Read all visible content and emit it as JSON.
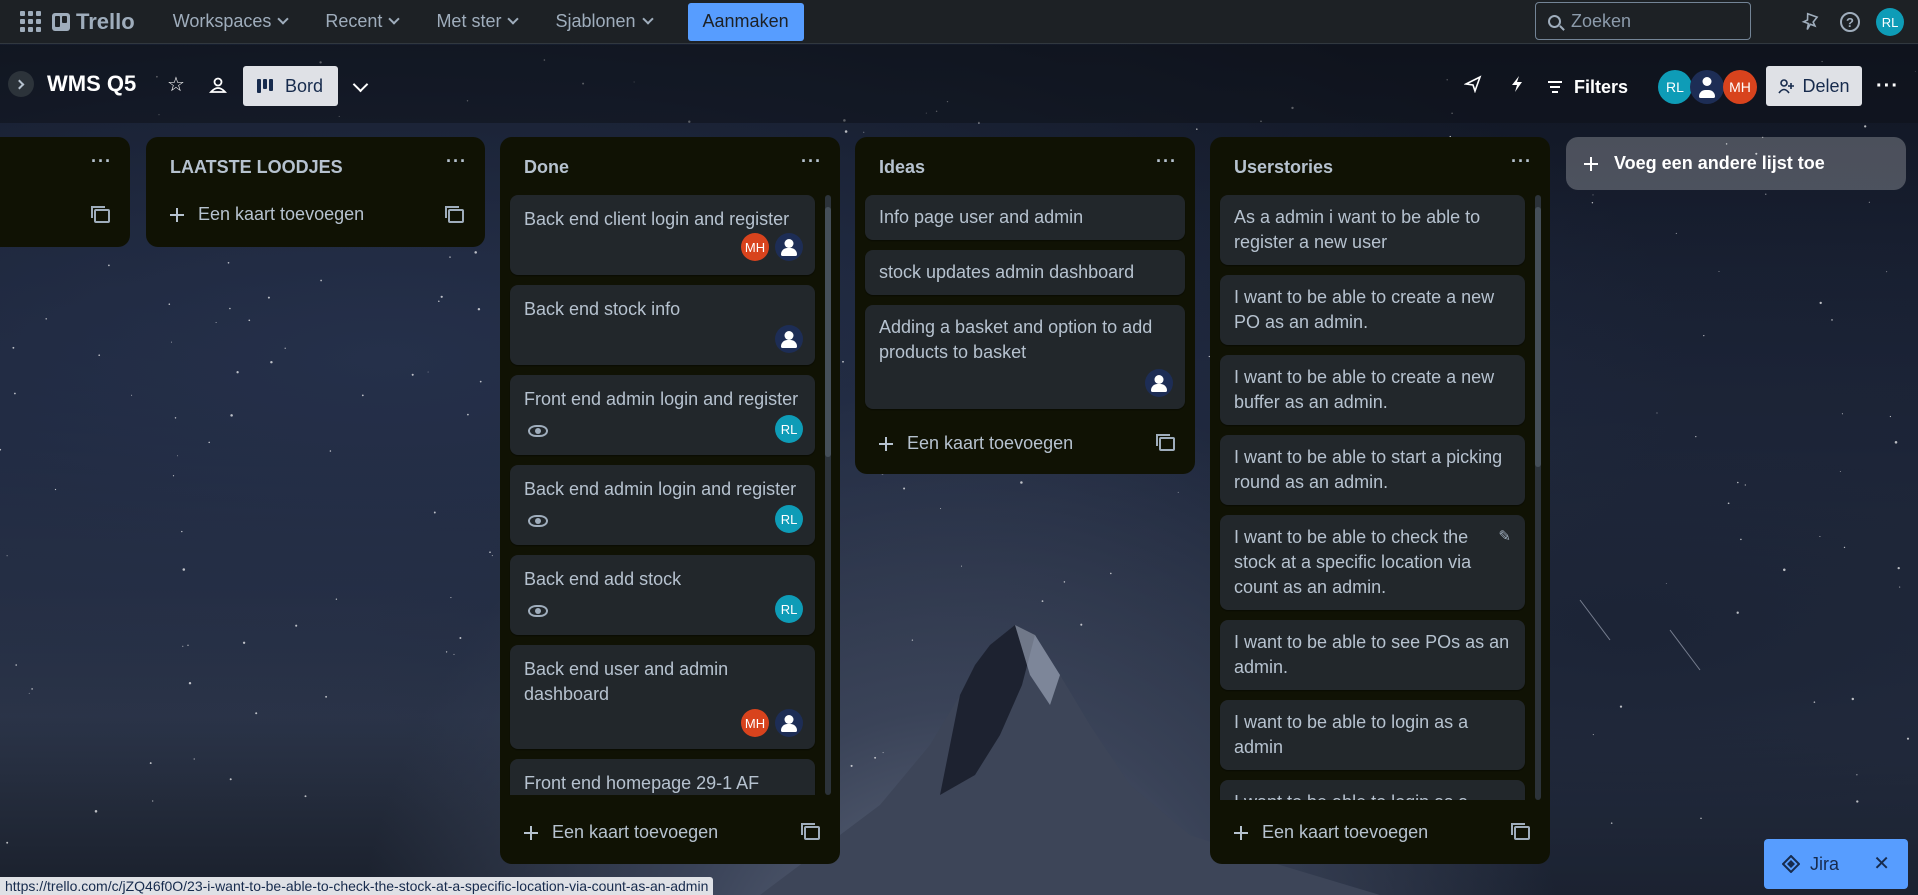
{
  "topnav": {
    "logo": "Trello",
    "items": [
      {
        "label": "Workspaces"
      },
      {
        "label": "Recent"
      },
      {
        "label": "Met ster"
      },
      {
        "label": "Sjablonen"
      }
    ],
    "create_label": "Aanmaken",
    "search_placeholder": "Zoeken",
    "user_initials": "RL"
  },
  "board": {
    "title": "WMS Q5",
    "view_label": "Bord",
    "filters_label": "Filters",
    "share_label": "Delen",
    "members": [
      {
        "initials": "RL",
        "color": "#0e9cb7"
      },
      {
        "initials": "",
        "color": "#1d2d55"
      },
      {
        "initials": "MH",
        "color": "#d8431d"
      }
    ]
  },
  "lists": [
    {
      "title": "",
      "cards": []
    },
    {
      "title": "LAATSTE LOODJES",
      "add_card": "Een kaart toevoegen",
      "cards": []
    },
    {
      "title": "Done",
      "add_card": "Een kaart toevoegen",
      "cards": [
        {
          "text": "Back end client login and register",
          "watch": false,
          "members": [
            "MH",
            "user"
          ]
        },
        {
          "text": "Back end stock info",
          "watch": false,
          "members": [
            "user"
          ]
        },
        {
          "text": "Front end admin login and register",
          "watch": true,
          "members": [
            "RL"
          ]
        },
        {
          "text": "Back end admin login and register",
          "watch": true,
          "members": [
            "RL"
          ]
        },
        {
          "text": "Back end add stock",
          "watch": true,
          "members": [
            "RL"
          ]
        },
        {
          "text": "Back end user and admin dashboard",
          "watch": false,
          "members": [
            "MH",
            "user"
          ]
        },
        {
          "text": "Front end homepage 29-1 AF",
          "watch": false,
          "members": []
        }
      ]
    },
    {
      "title": "Ideas",
      "add_card": "Een kaart toevoegen",
      "cards": [
        {
          "text": "Info page user and admin"
        },
        {
          "text": "stock updates admin dashboard"
        },
        {
          "text": "Adding a basket and option to add products to basket",
          "members": [
            "user"
          ]
        }
      ]
    },
    {
      "title": "Userstories",
      "add_card": "Een kaart toevoegen",
      "cards": [
        {
          "text": "As a admin i want to be able to register a new user"
        },
        {
          "text": "I want to be able to create a new PO as an admin."
        },
        {
          "text": "I want to be able to create a new buffer as an admin."
        },
        {
          "text": "I want to be able to start a picking round as an admin."
        },
        {
          "text": "I want to be able to check the stock at a specific location via count as an admin."
        },
        {
          "text": "I want to be able to see POs as an admin."
        },
        {
          "text": "I want to be able to login as a admin"
        },
        {
          "text": "I want to be able to login as a client"
        }
      ]
    }
  ],
  "add_list_label": "Voeg een andere lijst toe",
  "jira_label": "Jira",
  "status_url": "https://trello.com/c/jZQ46f0O/23-i-want-to-be-able-to-check-the-stock-at-a-specific-location-via-count-as-an-admin",
  "colors": {
    "accent": "#579dff",
    "list_bg": "#101204",
    "card_bg": "#22272b",
    "member_rl": "#0e9cb7",
    "member_mh": "#d8431d"
  }
}
